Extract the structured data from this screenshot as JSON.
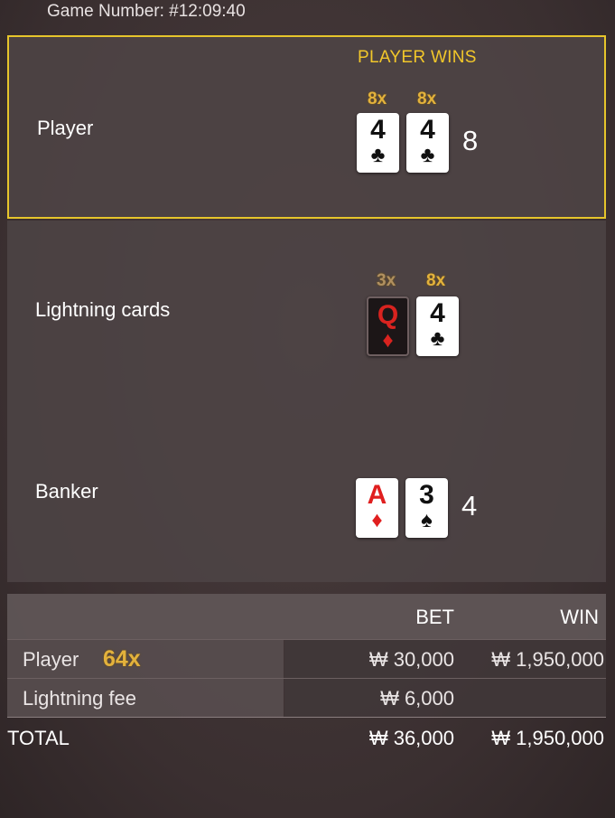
{
  "header": {
    "game_number": "Game Number: #12:09:40"
  },
  "player": {
    "label": "Player",
    "result": "PLAYER WINS",
    "cards": [
      {
        "rank": "4",
        "suit": "♣",
        "multiplier": "8x",
        "color": "black"
      },
      {
        "rank": "4",
        "suit": "♣",
        "multiplier": "8x",
        "color": "black"
      }
    ],
    "score": "8"
  },
  "lightning": {
    "label": "Lightning cards",
    "cards": [
      {
        "rank": "Q",
        "suit": "♦",
        "multiplier": "3x",
        "color": "red",
        "style": "dark"
      },
      {
        "rank": "4",
        "suit": "♣",
        "multiplier": "8x",
        "color": "black"
      }
    ]
  },
  "banker": {
    "label": "Banker",
    "cards": [
      {
        "rank": "A",
        "suit": "♦",
        "color": "red"
      },
      {
        "rank": "3",
        "suit": "♠",
        "color": "black"
      }
    ],
    "score": "4"
  },
  "bets": {
    "bet_header": "BET",
    "win_header": "WIN",
    "rows": [
      {
        "label": "Player",
        "multiplier": "64x",
        "bet": "₩ 30,000",
        "win": "₩ 1,950,000"
      },
      {
        "label": "Lightning fee",
        "bet": "₩ 6,000",
        "win": ""
      }
    ],
    "total": {
      "label": "TOTAL",
      "bet": "₩ 36,000",
      "win": "₩ 1,950,000"
    }
  },
  "colors": {
    "highlight_border": "#e6c52b",
    "multiplier_gold": "#e3b23c",
    "red_suit": "#e01f1f"
  }
}
